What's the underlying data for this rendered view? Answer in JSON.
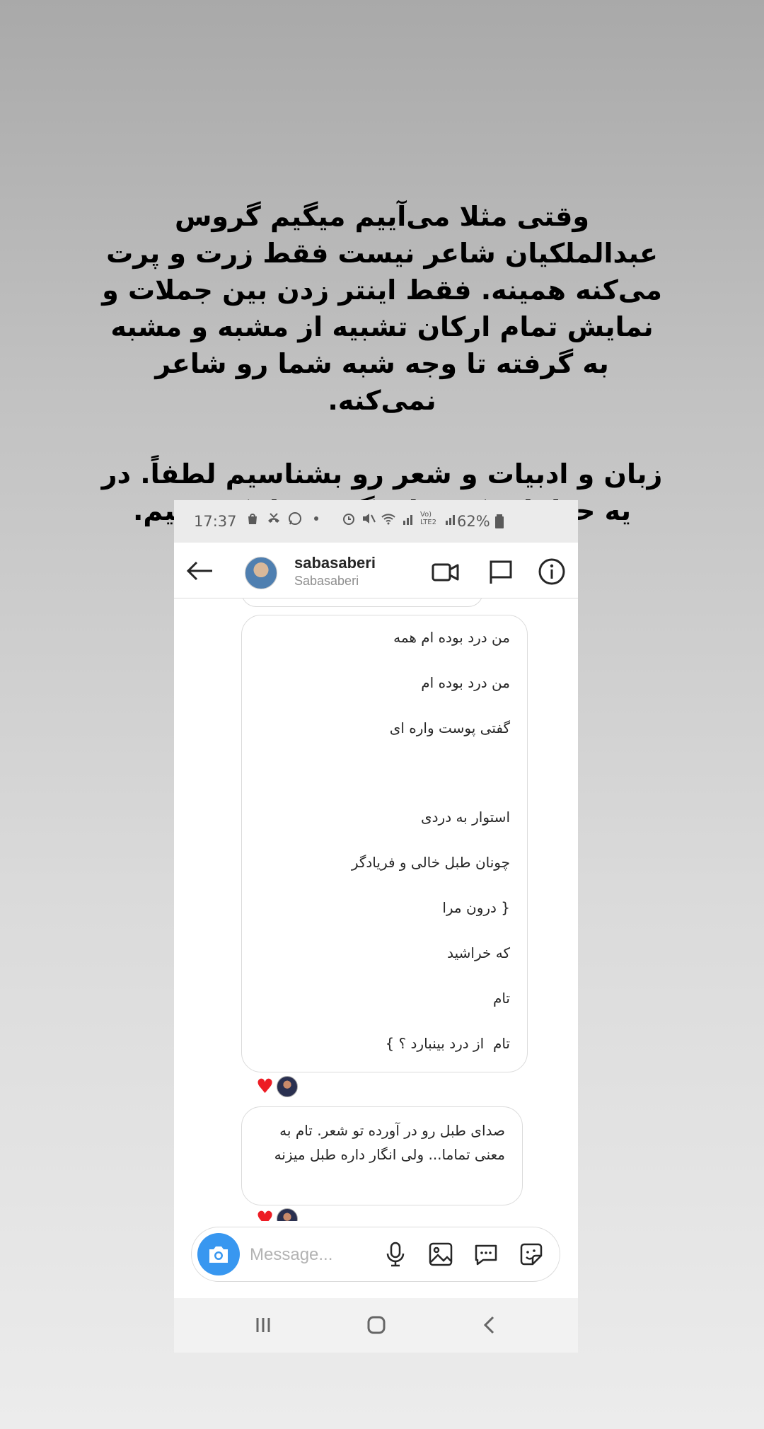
{
  "caption": {
    "paragraph1": "وقتی مثلا می‌آییم میگیم گروس عبدالملکیان شاعر نیست فقط زرت و پرت می‌کنه همینه. فقط اینتر زدن بین جملات و نمایش تمام ارکان تشبیه از مشبه و مشبه به گرفته تا وجه شبه شما رو شاعر نمی‌کنه.",
    "paragraph2": "زبان و ادبیات و شعر رو بشناسیم لطفاً. در یه حداقلی که برای گروس لایک نزنیم."
  },
  "status_bar": {
    "time": "17:37",
    "battery": "62%",
    "network_label": "Vo) LTE2"
  },
  "header": {
    "username": "sabasaberi",
    "subtitle": "Sabasaberi"
  },
  "messages": {
    "poem_lines": [
      "من درد بوده ام همه",
      "من درد بوده ام  ",
      "گفتی پوست واره ای",
      "استوار به دردی",
      "چونان طبل خالی و فریادگر",
      "{ درون مرا",
      "که خراشید",
      "تام  ",
      "تام  از درد بینبارد ؟ }"
    ],
    "reply_text": "صدای طبل رو در آورده تو شعر. تام به معنی تماما... ولی انگار داره طبل میزنه"
  },
  "composer": {
    "placeholder": "Message..."
  },
  "colors": {
    "accent_blue": "#3897f0",
    "heart_red": "#ed1c24"
  }
}
